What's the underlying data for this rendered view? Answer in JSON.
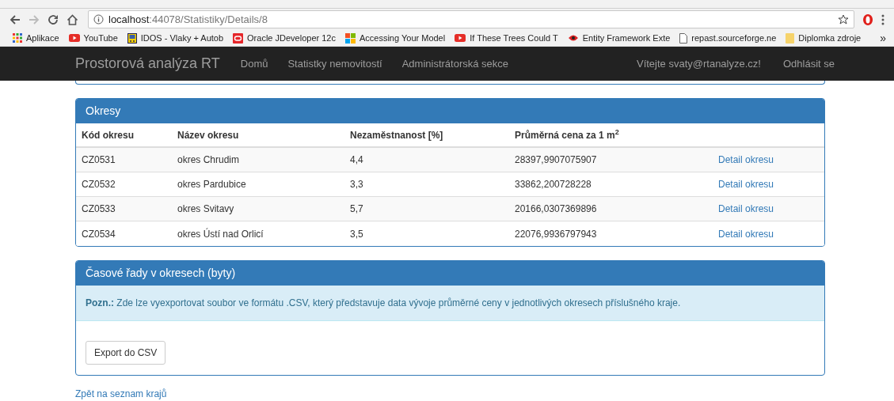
{
  "browser": {
    "address_host": "localhost",
    "address_rest": ":44078/Statistiky/Details/8",
    "bookmarks": [
      {
        "label": "Aplikace",
        "kind": "apps"
      },
      {
        "label": "YouTube",
        "kind": "video"
      },
      {
        "label": "IDOS - Vlaky + Autob",
        "kind": "train"
      },
      {
        "label": "Oracle JDeveloper 12c",
        "kind": "oracle"
      },
      {
        "label": "Accessing Your Model",
        "kind": "windows"
      },
      {
        "label": "If These Trees Could T",
        "kind": "video"
      },
      {
        "label": "Entity Framework Exte",
        "kind": "eye"
      },
      {
        "label": "repast.sourceforge.ne",
        "kind": "page"
      },
      {
        "label": "Diplomka zdroje",
        "kind": "folder"
      }
    ],
    "more": "»"
  },
  "navbar": {
    "brand": "Prostorová analýza RT",
    "links": [
      "Domů",
      "Statistky nemovitostí",
      "Administrátorská sekce"
    ],
    "greeting": "Vítejte svaty@rtanalyze.cz!",
    "logout": "Odhlásit se"
  },
  "districts": {
    "title": "Okresy",
    "columns": [
      "Kód okresu",
      "Název okresu",
      "Nezaměstnanost [%]",
      "Průměrná cena za 1 m$^{2}$"
    ],
    "rows": [
      {
        "code": "CZ0531",
        "name": "okres Chrudim",
        "unemployment": "4,4",
        "price": "28397,9907075907",
        "link": "Detail okresu"
      },
      {
        "code": "CZ0532",
        "name": "okres Pardubice",
        "unemployment": "3,3",
        "price": "33862,200728228",
        "link": "Detail okresu"
      },
      {
        "code": "CZ0533",
        "name": "okres Svitavy",
        "unemployment": "5,7",
        "price": "20166,0307369896",
        "link": "Detail okresu"
      },
      {
        "code": "CZ0534",
        "name": "okres Ústí nad Orlicí",
        "unemployment": "3,5",
        "price": "22076,9936797943",
        "link": "Detail okresu"
      }
    ]
  },
  "series": {
    "title": "Časové řady v okresech (byty)",
    "note": "**Pozn.:** Zde lze vyexportovat soubor ve formátu .CSV, který představuje data vývoje průměrné ceny v jednotlivých okresech příslušného kraje.",
    "button": "Export do CSV"
  },
  "back_link": "Zpět na seznam krajů"
}
